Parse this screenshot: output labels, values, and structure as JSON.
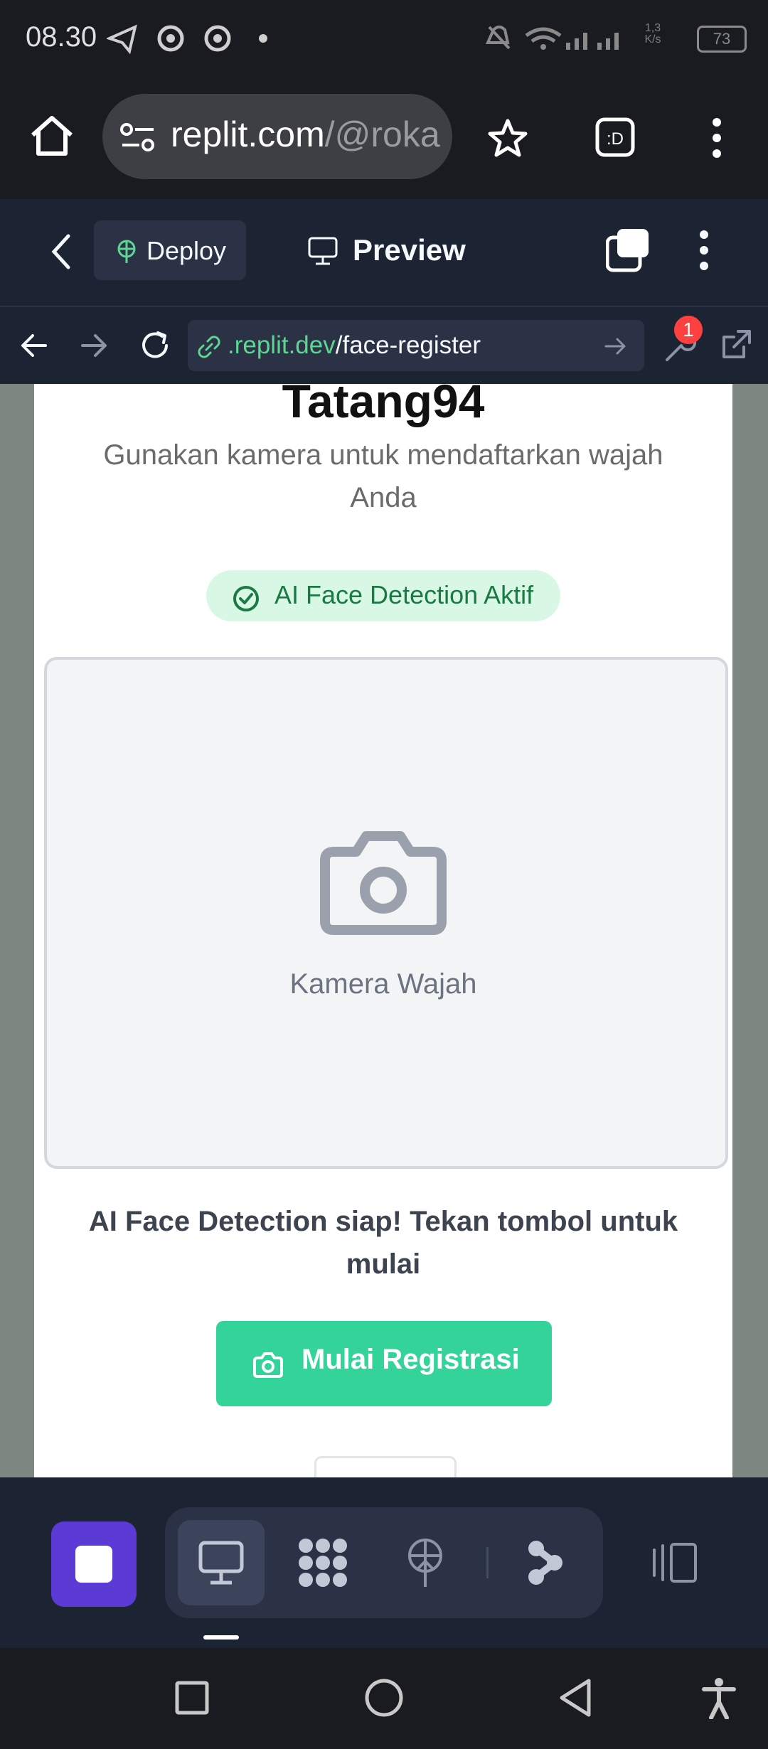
{
  "status_bar": {
    "time": "08.30",
    "network_speed": "1,3\nK/s",
    "battery": "73"
  },
  "browser": {
    "url_host": "replit.com",
    "url_path": "/@roka"
  },
  "replit_header": {
    "deploy_label": "Deploy",
    "preview_label": "Preview"
  },
  "nav_bar": {
    "url_domain": ".replit.dev",
    "url_path": "/face-register",
    "devtools_badge": "1"
  },
  "page": {
    "username": "Tatang94",
    "subtitle": "Gunakan kamera untuk mendaftarkan wajah Anda",
    "ai_badge": "AI Face Detection Aktif",
    "camera_label": "Kamera Wajah",
    "status_message": "AI Face Detection siap! Tekan tombol untuk mulai",
    "start_button": "Mulai Registrasi"
  },
  "colors": {
    "replit_bg": "#1c2333",
    "accent_green": "#34d399",
    "stop_purple": "#5b3ad6",
    "badge_red": "#ff4040"
  }
}
